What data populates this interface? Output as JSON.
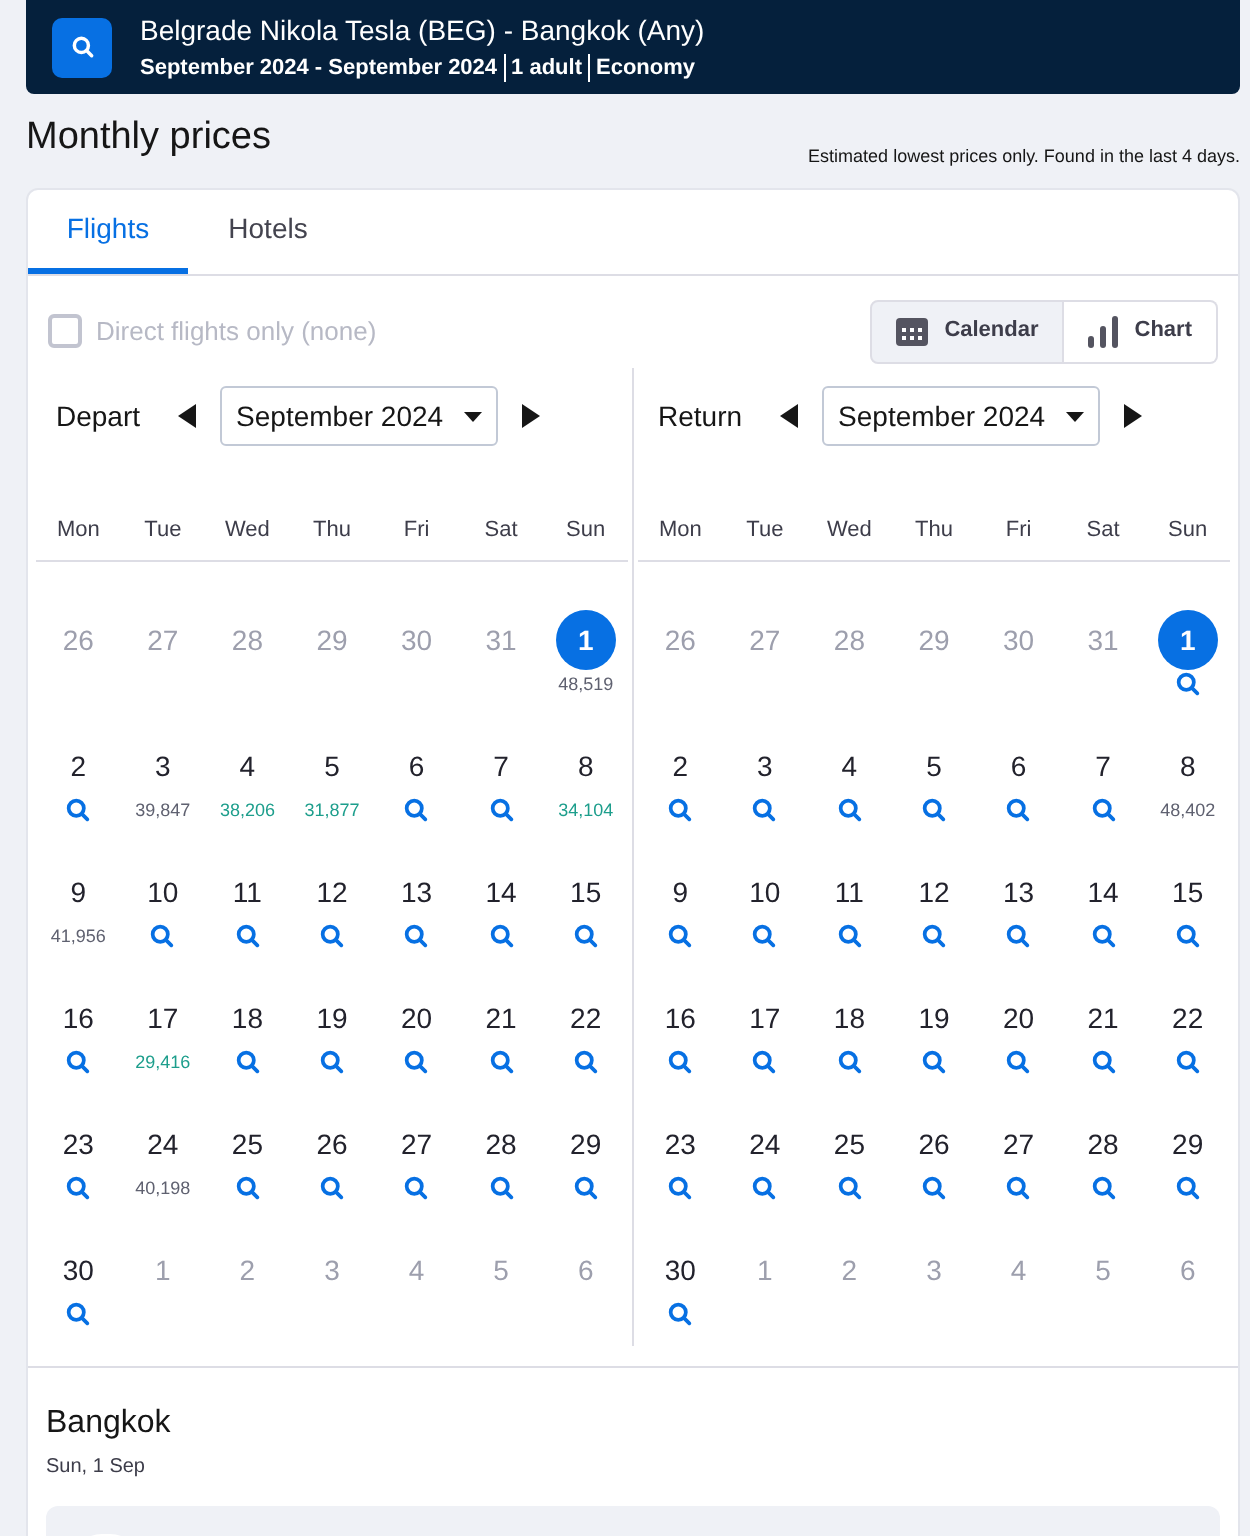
{
  "header": {
    "route": "Belgrade Nikola Tesla (BEG) - Bangkok (Any)",
    "details": [
      "September 2024 - September 2024",
      "1 adult",
      "Economy"
    ]
  },
  "title": "Monthly prices",
  "note": "Estimated lowest prices only. Found in the last 4 days.",
  "tabs": [
    {
      "label": "Flights",
      "selected": true
    },
    {
      "label": "Hotels",
      "selected": false
    }
  ],
  "direct_only": {
    "label": "Direct flights only (none)",
    "checked": false,
    "disabled": true
  },
  "view_toggle": [
    {
      "label": "Calendar",
      "kind": "calendar",
      "selected": true
    },
    {
      "label": "Chart",
      "kind": "chart",
      "selected": false
    }
  ],
  "calendars": [
    {
      "label": "Depart",
      "month": "September 2024",
      "weekdays": [
        "Mon",
        "Tue",
        "Wed",
        "Thu",
        "Fri",
        "Sat",
        "Sun"
      ],
      "days": [
        {
          "day": "26",
          "kind": "outside",
          "selected": false
        },
        {
          "day": "27",
          "kind": "outside",
          "selected": false
        },
        {
          "day": "28",
          "kind": "outside",
          "selected": false
        },
        {
          "day": "29",
          "kind": "outside",
          "selected": false
        },
        {
          "day": "30",
          "kind": "outside",
          "selected": false
        },
        {
          "day": "31",
          "kind": "outside",
          "selected": false
        },
        {
          "day": "1",
          "kind": "price",
          "selected": true,
          "price": "48,519",
          "color": "#5f6170"
        },
        {
          "day": "2",
          "kind": "search",
          "selected": false
        },
        {
          "day": "3",
          "kind": "price",
          "selected": false,
          "price": "39,847",
          "color": "#5f6170"
        },
        {
          "day": "4",
          "kind": "price",
          "selected": false,
          "price": "38,206",
          "color": "#1d9e8c"
        },
        {
          "day": "5",
          "kind": "price",
          "selected": false,
          "price": "31,877",
          "color": "#1d9e8c"
        },
        {
          "day": "6",
          "kind": "search",
          "selected": false
        },
        {
          "day": "7",
          "kind": "search",
          "selected": false
        },
        {
          "day": "8",
          "kind": "price",
          "selected": false,
          "price": "34,104",
          "color": "#1d9e8c"
        },
        {
          "day": "9",
          "kind": "price",
          "selected": false,
          "price": "41,956",
          "color": "#5f6170"
        },
        {
          "day": "10",
          "kind": "search",
          "selected": false
        },
        {
          "day": "11",
          "kind": "search",
          "selected": false
        },
        {
          "day": "12",
          "kind": "search",
          "selected": false
        },
        {
          "day": "13",
          "kind": "search",
          "selected": false
        },
        {
          "day": "14",
          "kind": "search",
          "selected": false
        },
        {
          "day": "15",
          "kind": "search",
          "selected": false
        },
        {
          "day": "16",
          "kind": "search",
          "selected": false
        },
        {
          "day": "17",
          "kind": "price",
          "selected": false,
          "price": "29,416",
          "color": "#1d9e8c"
        },
        {
          "day": "18",
          "kind": "search",
          "selected": false
        },
        {
          "day": "19",
          "kind": "search",
          "selected": false
        },
        {
          "day": "20",
          "kind": "search",
          "selected": false
        },
        {
          "day": "21",
          "kind": "search",
          "selected": false
        },
        {
          "day": "22",
          "kind": "search",
          "selected": false
        },
        {
          "day": "23",
          "kind": "search",
          "selected": false
        },
        {
          "day": "24",
          "kind": "price",
          "selected": false,
          "price": "40,198",
          "color": "#5f6170"
        },
        {
          "day": "25",
          "kind": "search",
          "selected": false
        },
        {
          "day": "26",
          "kind": "search",
          "selected": false
        },
        {
          "day": "27",
          "kind": "search",
          "selected": false
        },
        {
          "day": "28",
          "kind": "search",
          "selected": false
        },
        {
          "day": "29",
          "kind": "search",
          "selected": false
        },
        {
          "day": "30",
          "kind": "search",
          "selected": false
        },
        {
          "day": "1",
          "kind": "outside",
          "selected": false
        },
        {
          "day": "2",
          "kind": "outside",
          "selected": false
        },
        {
          "day": "3",
          "kind": "outside",
          "selected": false
        },
        {
          "day": "4",
          "kind": "outside",
          "selected": false
        },
        {
          "day": "5",
          "kind": "outside",
          "selected": false
        },
        {
          "day": "6",
          "kind": "outside",
          "selected": false
        }
      ]
    },
    {
      "label": "Return",
      "month": "September 2024",
      "weekdays": [
        "Mon",
        "Tue",
        "Wed",
        "Thu",
        "Fri",
        "Sat",
        "Sun"
      ],
      "days": [
        {
          "day": "26",
          "kind": "outside",
          "selected": false
        },
        {
          "day": "27",
          "kind": "outside",
          "selected": false
        },
        {
          "day": "28",
          "kind": "outside",
          "selected": false
        },
        {
          "day": "29",
          "kind": "outside",
          "selected": false
        },
        {
          "day": "30",
          "kind": "outside",
          "selected": false
        },
        {
          "day": "31",
          "kind": "outside",
          "selected": false
        },
        {
          "day": "1",
          "kind": "search",
          "selected": true
        },
        {
          "day": "2",
          "kind": "search",
          "selected": false
        },
        {
          "day": "3",
          "kind": "search",
          "selected": false
        },
        {
          "day": "4",
          "kind": "search",
          "selected": false
        },
        {
          "day": "5",
          "kind": "search",
          "selected": false
        },
        {
          "day": "6",
          "kind": "search",
          "selected": false
        },
        {
          "day": "7",
          "kind": "search",
          "selected": false
        },
        {
          "day": "8",
          "kind": "price",
          "selected": false,
          "price": "48,402",
          "color": "#5f6170"
        },
        {
          "day": "9",
          "kind": "search",
          "selected": false
        },
        {
          "day": "10",
          "kind": "search",
          "selected": false
        },
        {
          "day": "11",
          "kind": "search",
          "selected": false
        },
        {
          "day": "12",
          "kind": "search",
          "selected": false
        },
        {
          "day": "13",
          "kind": "search",
          "selected": false
        },
        {
          "day": "14",
          "kind": "search",
          "selected": false
        },
        {
          "day": "15",
          "kind": "search",
          "selected": false
        },
        {
          "day": "16",
          "kind": "search",
          "selected": false
        },
        {
          "day": "17",
          "kind": "search",
          "selected": false
        },
        {
          "day": "18",
          "kind": "search",
          "selected": false
        },
        {
          "day": "19",
          "kind": "search",
          "selected": false
        },
        {
          "day": "20",
          "kind": "search",
          "selected": false
        },
        {
          "day": "21",
          "kind": "search",
          "selected": false
        },
        {
          "day": "22",
          "kind": "search",
          "selected": false
        },
        {
          "day": "23",
          "kind": "search",
          "selected": false
        },
        {
          "day": "24",
          "kind": "search",
          "selected": false
        },
        {
          "day": "25",
          "kind": "search",
          "selected": false
        },
        {
          "day": "26",
          "kind": "search",
          "selected": false
        },
        {
          "day": "27",
          "kind": "search",
          "selected": false
        },
        {
          "day": "28",
          "kind": "search",
          "selected": false
        },
        {
          "day": "29",
          "kind": "search",
          "selected": false
        },
        {
          "day": "30",
          "kind": "search",
          "selected": false
        },
        {
          "day": "1",
          "kind": "outside",
          "selected": false
        },
        {
          "day": "2",
          "kind": "outside",
          "selected": false
        },
        {
          "day": "3",
          "kind": "outside",
          "selected": false
        },
        {
          "day": "4",
          "kind": "outside",
          "selected": false
        },
        {
          "day": "5",
          "kind": "outside",
          "selected": false
        },
        {
          "day": "6",
          "kind": "outside",
          "selected": false
        }
      ]
    }
  ],
  "result": {
    "city": "Bangkok",
    "date": "Sun, 1 Sep"
  }
}
